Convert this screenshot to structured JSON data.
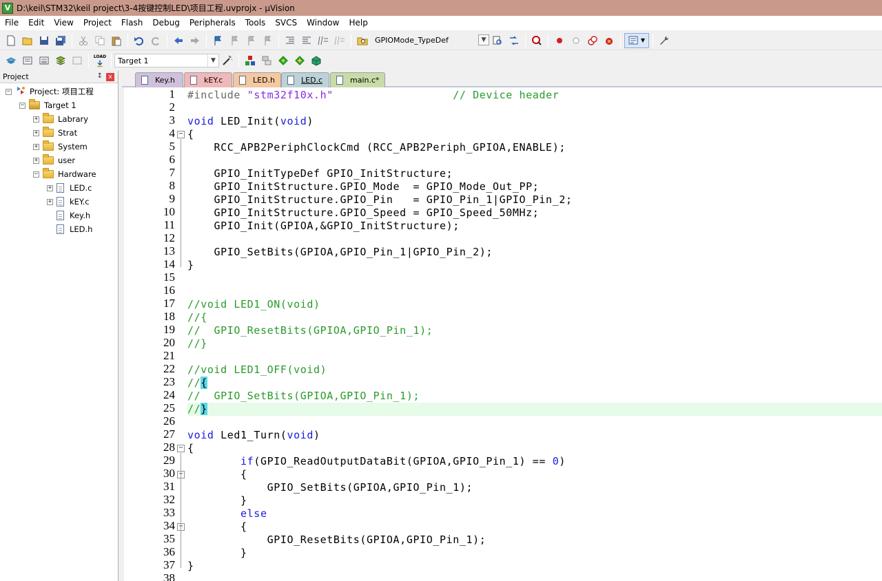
{
  "window": {
    "title": "D:\\keil\\STM32\\keil project\\3-4按键控制LED\\项目工程.uvprojx - µVision",
    "app_icon": "V"
  },
  "menu": [
    "File",
    "Edit",
    "View",
    "Project",
    "Flash",
    "Debug",
    "Peripherals",
    "Tools",
    "SVCS",
    "Window",
    "Help"
  ],
  "toolbar1": {
    "find_combo_value": "GPIOMode_TypeDef"
  },
  "toolbar2": {
    "load_label": "LOAD",
    "target_combo_value": "Target 1"
  },
  "project_panel": {
    "header": "Project",
    "pin": "↕",
    "close": "x",
    "tree": [
      {
        "label": "Project: 项目工程",
        "level": 0,
        "expander": "−",
        "icon": "project-icon"
      },
      {
        "label": "Target 1",
        "level": 1,
        "expander": "−",
        "icon": "target-icon"
      },
      {
        "label": "Labrary",
        "level": 2,
        "expander": "+",
        "icon": "folder-icon"
      },
      {
        "label": "Strat",
        "level": 2,
        "expander": "+",
        "icon": "folder-icon"
      },
      {
        "label": "System",
        "level": 2,
        "expander": "+",
        "icon": "folder-icon"
      },
      {
        "label": "user",
        "level": 2,
        "expander": "+",
        "icon": "folder-icon"
      },
      {
        "label": "Hardware",
        "level": 2,
        "expander": "−",
        "icon": "folder-open-icon"
      },
      {
        "label": "LED.c",
        "level": 3,
        "expander": "+",
        "icon": "file-icon"
      },
      {
        "label": "kEY.c",
        "level": 3,
        "expander": "+",
        "icon": "file-icon"
      },
      {
        "label": "Key.h",
        "level": 3,
        "expander": "",
        "icon": "file-icon"
      },
      {
        "label": "LED.h",
        "level": 3,
        "expander": "",
        "icon": "file-icon"
      }
    ]
  },
  "tabs": [
    {
      "label": "Key.h",
      "color": "#cfc0dc",
      "active": false
    },
    {
      "label": "kEY.c",
      "color": "#f0b8b8",
      "active": false
    },
    {
      "label": "LED.h",
      "color": "#f4c8a0",
      "active": false
    },
    {
      "label": "LED.c",
      "color": "#bcd2d8",
      "active": true
    },
    {
      "label": "main.c*",
      "color": "#c8dca8",
      "active": false
    }
  ],
  "editor": {
    "highlight_line": 25,
    "lines": [
      "#include \"stm32f10x.h\"                  // Device header",
      "",
      "void LED_Init(void)",
      "{",
      "    RCC_APB2PeriphClockCmd (RCC_APB2Periph_GPIOA,ENABLE);",
      "",
      "    GPIO_InitTypeDef GPIO_InitStructure;",
      "    GPIO_InitStructure.GPIO_Mode  = GPIO_Mode_Out_PP;",
      "    GPIO_InitStructure.GPIO_Pin   = GPIO_Pin_1|GPIO_Pin_2;",
      "    GPIO_InitStructure.GPIO_Speed = GPIO_Speed_50MHz;",
      "    GPIO_Init(GPIOA,&GPIO_InitStructure);",
      "",
      "    GPIO_SetBits(GPIOA,GPIO_Pin_1|GPIO_Pin_2);",
      "}",
      "",
      "",
      "//void LED1_ON(void)",
      "//{",
      "//  GPIO_ResetBits(GPIOA,GPIO_Pin_1);",
      "//}",
      "",
      "//void LED1_OFF(void)",
      "//{",
      "//  GPIO_SetBits(GPIOA,GPIO_Pin_1);",
      "//}",
      "",
      "void Led1_Turn(void)",
      "{",
      "        if(GPIO_ReadOutputDataBit(GPIOA,GPIO_Pin_1) == 0)",
      "        {",
      "            GPIO_SetBits(GPIOA,GPIO_Pin_1);",
      "        }",
      "        else",
      "        {",
      "            GPIO_ResetBits(GPIOA,GPIO_Pin_1);",
      "        }",
      "}",
      ""
    ],
    "line_numbers": [
      "1",
      "2",
      "3",
      "4",
      "5",
      "6",
      "7",
      "8",
      "9",
      "10",
      "11",
      "12",
      "13",
      "14",
      "15",
      "16",
      "17",
      "18",
      "19",
      "20",
      "21",
      "22",
      "23",
      "24",
      "25",
      "26",
      "27",
      "28",
      "29",
      "30",
      "31",
      "32",
      "33",
      "34",
      "35",
      "36",
      "37",
      "38"
    ],
    "fold_markers": [
      {
        "line": 4,
        "sign": "−"
      },
      {
        "line": 28,
        "sign": "−"
      },
      {
        "line": 30,
        "sign": "−"
      },
      {
        "line": 34,
        "sign": "−"
      }
    ]
  }
}
